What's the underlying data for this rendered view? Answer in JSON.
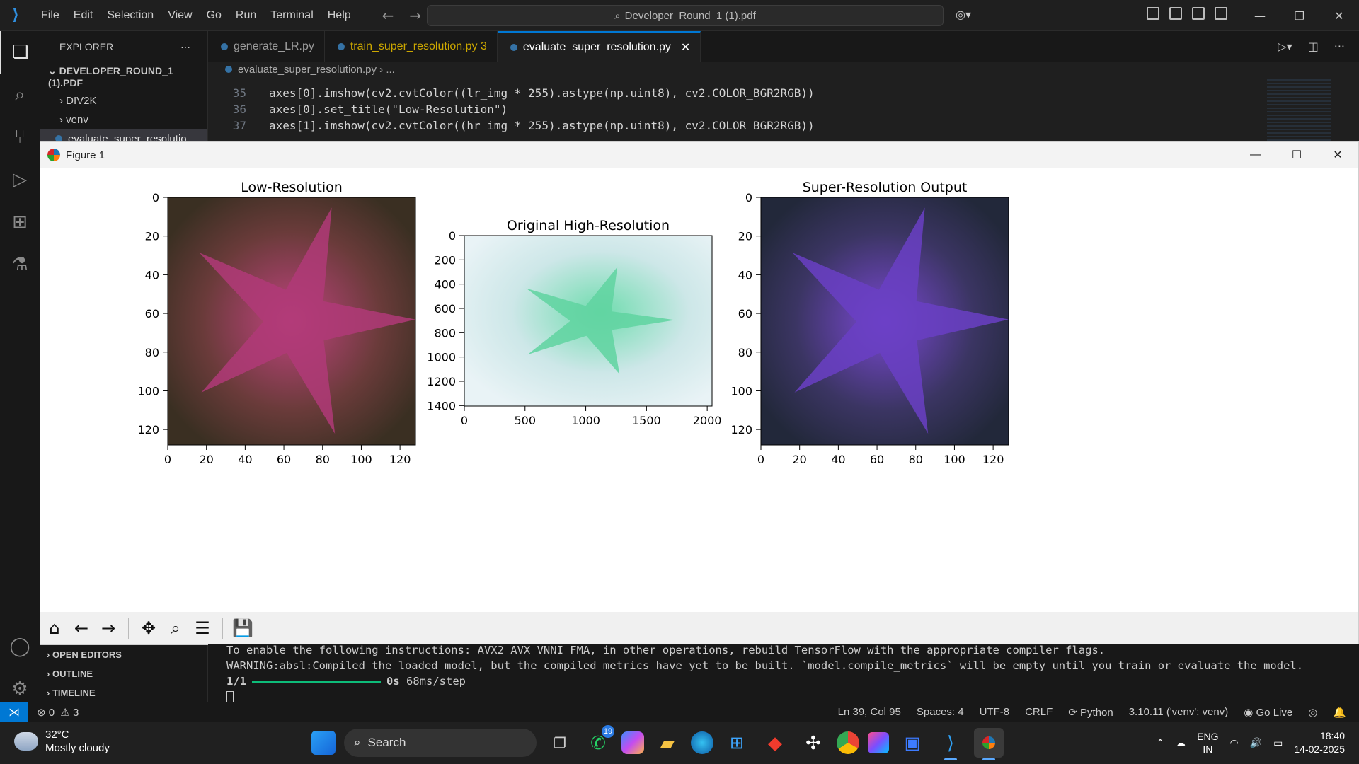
{
  "titlebar": {
    "menu": [
      "File",
      "Edit",
      "Selection",
      "View",
      "Go",
      "Run",
      "Terminal",
      "Help"
    ],
    "command_center": "Developer_Round_1 (1).pdf"
  },
  "sidebar": {
    "title": "EXPLORER",
    "more": "···",
    "folder": "DEVELOPER_ROUND_1 (1).PDF",
    "items": [
      {
        "label": "DIV2K",
        "type": "folder"
      },
      {
        "label": "venv",
        "type": "folder"
      },
      {
        "label": "evaluate_super_resolutio...",
        "type": "file"
      }
    ],
    "sections": [
      "OPEN EDITORS",
      "OUTLINE",
      "TIMELINE"
    ]
  },
  "tabs": [
    {
      "label": "generate_LR.py",
      "badge": "",
      "state": "normal"
    },
    {
      "label": "train_super_resolution.py",
      "badge": "3",
      "state": "warning"
    },
    {
      "label": "evaluate_super_resolution.py",
      "badge": "",
      "state": "active"
    }
  ],
  "breadcrumb": {
    "file": "evaluate_super_resolution.py",
    "rest": "..."
  },
  "editor": {
    "lines": [
      {
        "num": "35",
        "code": "axes[0].imshow(cv2.cvtColor((lr_img * 255).astype(np.uint8), cv2.COLOR_BGR2RGB))"
      },
      {
        "num": "36",
        "code": "axes[0].set_title(\"Low-Resolution\")"
      },
      {
        "num": "37",
        "code": "axes[1].imshow(cv2.cvtColor((hr_img * 255).astype(np.uint8), cv2.COLOR_BGR2RGB))"
      }
    ]
  },
  "figure": {
    "window_title": "Figure 1",
    "toolbar": [
      "home-icon",
      "back-icon",
      "forward-icon",
      "pan-icon",
      "zoom-icon",
      "configure-icon",
      "save-icon"
    ]
  },
  "chart_data": [
    {
      "type": "image",
      "title": "Low-Resolution",
      "xticks": [
        "0",
        "20",
        "40",
        "60",
        "80",
        "100",
        "120"
      ],
      "yticks": [
        "0",
        "20",
        "40",
        "60",
        "80",
        "100",
        "120"
      ],
      "xlim": [
        0,
        128
      ],
      "ylim": [
        128,
        0
      ],
      "dominant_color": "#b03a78"
    },
    {
      "type": "image",
      "title": "Original High-Resolution",
      "xticks": [
        "0",
        "500",
        "1000",
        "1500",
        "2000"
      ],
      "yticks": [
        "0",
        "200",
        "400",
        "600",
        "800",
        "1000",
        "1200",
        "1400"
      ],
      "xlim": [
        0,
        2040
      ],
      "ylim": [
        1404,
        0
      ],
      "dominant_color": "#5fd3a0"
    },
    {
      "type": "image",
      "title": "Super-Resolution Output",
      "xticks": [
        "0",
        "20",
        "40",
        "60",
        "80",
        "100",
        "120"
      ],
      "yticks": [
        "0",
        "20",
        "40",
        "60",
        "80",
        "100",
        "120"
      ],
      "xlim": [
        0,
        128
      ],
      "ylim": [
        128,
        0
      ],
      "dominant_color": "#6a3fc4"
    }
  ],
  "terminal": {
    "line1": "To enable the following instructions: AVX2 AVX_VNNI FMA, in other operations, rebuild TensorFlow with the appropriate compiler flags.",
    "line2": "WARNING:absl:Compiled the loaded model, but the compiled metrics have yet to be built. `model.compile_metrics` will be empty until you train or evaluate the model.",
    "progress_label": "1/1",
    "progress_fraction": 1.0,
    "progress_time": "0s",
    "progress_rate": "68ms/step"
  },
  "statusbar": {
    "errors": "0",
    "warnings": "3",
    "position": "Ln 39, Col 95",
    "spaces": "Spaces: 4",
    "encoding": "UTF-8",
    "eol": "CRLF",
    "language": "Python",
    "interpreter": "3.10.11 ('venv': venv)",
    "golive": "Go Live"
  },
  "taskbar": {
    "temp": "32°C",
    "weather": "Mostly cloudy",
    "search": "Search",
    "whatsapp_badge": "19",
    "lang_top": "ENG",
    "lang_bottom": "IN",
    "time": "18:40",
    "date": "14-02-2025"
  }
}
